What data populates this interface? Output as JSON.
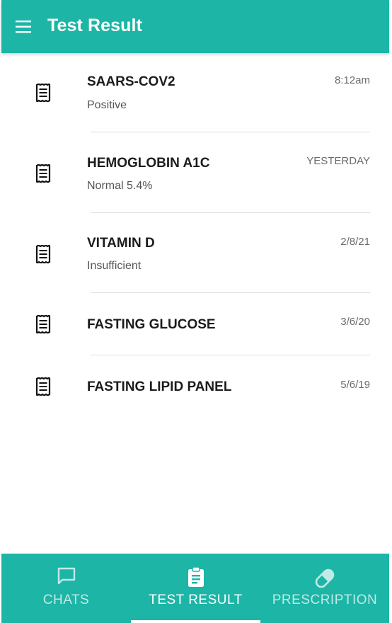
{
  "appbar": {
    "title": "Test Result",
    "menu_icon": "menu-icon"
  },
  "results": [
    {
      "name": "SAARS-COV2",
      "detail": "Positive",
      "date": "8:12am",
      "icon": "document-icon"
    },
    {
      "name": "HEMOGLOBIN A1C",
      "detail": "Normal 5.4%",
      "date": "YESTERDAY",
      "icon": "document-icon"
    },
    {
      "name": "VITAMIN D",
      "detail": "Insufficient",
      "date": "2/8/21",
      "icon": "document-icon"
    },
    {
      "name": "FASTING GLUCOSE",
      "detail": "",
      "date": "3/6/20",
      "icon": "document-icon"
    },
    {
      "name": "FASTING LIPID PANEL",
      "detail": "",
      "date": "5/6/19",
      "icon": "document-icon"
    }
  ],
  "tabs": [
    {
      "label": "CHATS",
      "icon": "chat-bubble-icon",
      "active": false
    },
    {
      "label": "TEST RESULT",
      "icon": "clipboard-icon",
      "active": true
    },
    {
      "label": "PRESCRIPTION",
      "icon": "pill-icon",
      "active": false
    }
  ],
  "colors": {
    "primary": "#1db5a6",
    "on_primary": "#ffffff",
    "divider": "#dcdcdc"
  }
}
